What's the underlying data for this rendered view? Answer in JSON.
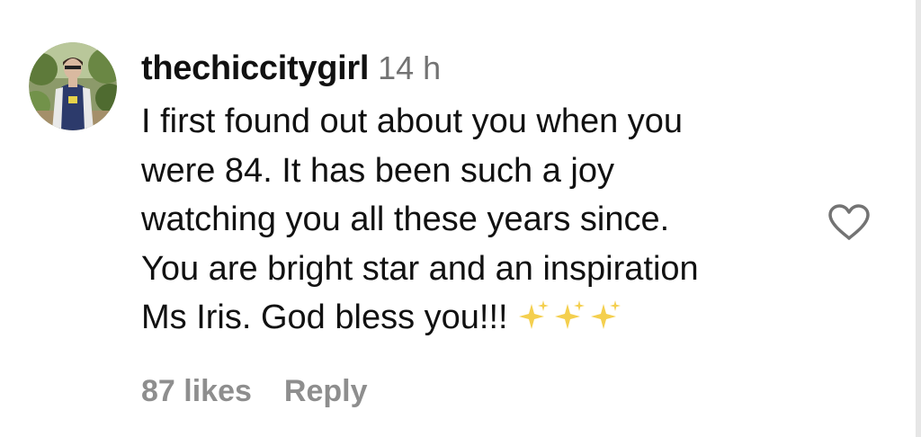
{
  "comment": {
    "username": "thechiccitygirl",
    "timestamp": "14 h",
    "text_lines": [
      "I first found out about you when you",
      "were 84. It has been such a joy",
      "watching you all these years since.",
      "You are bright star and an inspiration",
      "Ms Iris. God bless you!!!"
    ],
    "emoji": "sparkles-emoji",
    "likes": "87 likes",
    "reply_label": "Reply"
  },
  "icons": {
    "like": "heart-outline-icon"
  },
  "colors": {
    "text": "#111111",
    "secondary": "#737373",
    "action": "#8e8e8e",
    "sparkle": "#f4cf4e"
  }
}
